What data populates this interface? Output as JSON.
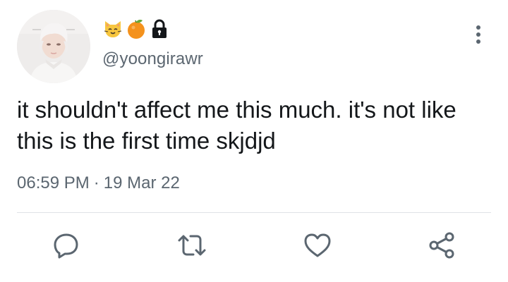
{
  "user": {
    "handle": "@yoongirawr",
    "display_name_emojis": [
      "cat-face",
      "tangerine",
      "padlock"
    ]
  },
  "tweet": {
    "text": "it shouldn't affect me this much. it's not like this is the first time skjdjd",
    "time": "06:59 PM",
    "separator": "·",
    "date": "19 Mar 22"
  },
  "actions": [
    "reply",
    "retweet",
    "like",
    "share"
  ],
  "colors": {
    "text": "#14171a",
    "secondary": "#5b6670",
    "icon": "#5b6670",
    "divider": "#dfe3e6",
    "cat": "#f7c63f",
    "tangerine": "#f4921d",
    "leaf": "#67a83a"
  }
}
